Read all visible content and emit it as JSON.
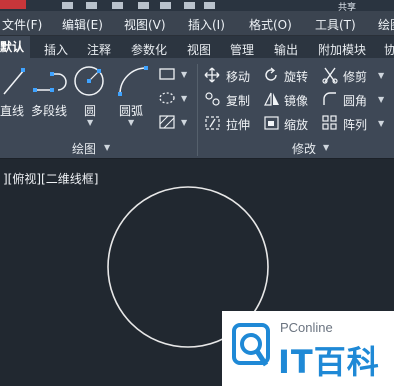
{
  "top_strip": {
    "share_label": "共享"
  },
  "menubar": {
    "items": [
      "文件(F)",
      "编辑(E)",
      "视图(V)",
      "插入(I)",
      "格式(O)",
      "工具(T)",
      "绘图"
    ]
  },
  "ribbon_tabs": {
    "items": [
      "默认",
      "插入",
      "注释",
      "参数化",
      "视图",
      "管理",
      "输出",
      "附加模块",
      "协"
    ],
    "active": "默认"
  },
  "draw_panel": {
    "line": "直线",
    "polyline": "多段线",
    "circle": "圆",
    "arc": "圆弧",
    "footer": "绘图"
  },
  "modify_panel": {
    "move": "移动",
    "rotate": "旋转",
    "trim": "修剪",
    "copy": "复制",
    "mirror": "镜像",
    "fillet": "圆角",
    "stretch": "拉伸",
    "scale": "缩放",
    "array": "阵列",
    "footer": "修改"
  },
  "viewport": {
    "label": "][俯视][二维线框]"
  },
  "watermark": {
    "small": "PConline",
    "brand": "IT百科"
  },
  "colors": {
    "canvas": "#212830",
    "ribbon": "#3e4856",
    "accent_blue": "#1f89d6",
    "circle": "#e8e8e8"
  }
}
